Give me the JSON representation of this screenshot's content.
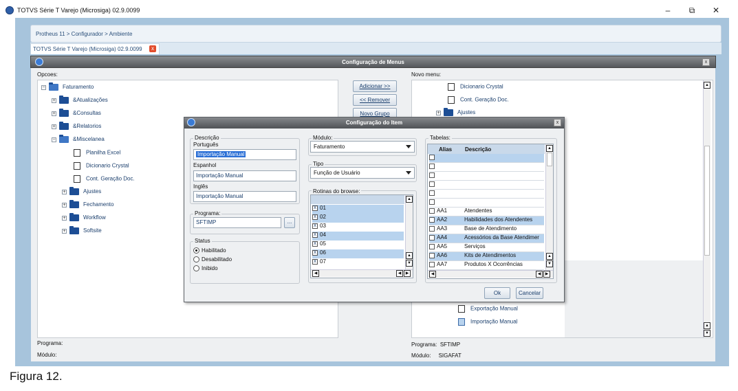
{
  "window": {
    "title": "TOTVS Série T Varejo (Microsiga) 02.9.0099",
    "minimize": "–",
    "maximize": "⧉",
    "close": "✕"
  },
  "breadcrumb": "Protheus 11 > Configurador > Ambiente",
  "tab": {
    "label": "TOTVS Série T Varejo (Microsiga) 02.9.0099",
    "close": "x"
  },
  "dialog": {
    "title": "Configuração de Menus",
    "close": "x"
  },
  "left": {
    "label": "Opcoes:",
    "tree": [
      {
        "label": "Faturamento",
        "kind": "folder"
      },
      {
        "label": "&Atualizações",
        "kind": "folder"
      },
      {
        "label": "&Consultas",
        "kind": "folder"
      },
      {
        "label": "&Relatorios",
        "kind": "folder"
      },
      {
        "label": "&Miscelanea",
        "kind": "folder"
      },
      {
        "label": "Planilha Excel",
        "kind": "doc"
      },
      {
        "label": "Dicionario Crystal",
        "kind": "doc"
      },
      {
        "label": "Cont. Geração Doc.",
        "kind": "doc"
      },
      {
        "label": "Ajustes",
        "kind": "folder"
      },
      {
        "label": "Fechamento",
        "kind": "folder"
      },
      {
        "label": "Workflow",
        "kind": "folder"
      },
      {
        "label": "Softsite",
        "kind": "folder"
      }
    ],
    "programa_label": "Programa:",
    "modulo_label": "Módulo:"
  },
  "buttons": {
    "adicionar": "Adicionar >>",
    "remover": "<< Remover",
    "novo_grupo": "Novo Grupo"
  },
  "right": {
    "label": "Novo menu:",
    "tree_top": [
      "Dicionario Crystal",
      "Cont. Geração Doc.",
      "Ajustes"
    ],
    "tree_bottom": [
      "Exportação Manual",
      "Importação Manual"
    ],
    "programa_label": "Programa:",
    "programa_value": "SFTIMP",
    "modulo_label": "Módulo:",
    "modulo_value": "SIGAFAT"
  },
  "item_dialog": {
    "title": "Configuração do Item",
    "descricao": {
      "legend": "Descrição",
      "portugues_label": "Português",
      "portugues_value": "Importação Manual",
      "espanhol_label": "Espanhol",
      "espanhol_value": "Importação Manual",
      "ingles_label": "Inglês",
      "ingles_value": "Importação Manual"
    },
    "programa": {
      "legend": "Programa:",
      "value": "SFTIMP",
      "browse": "..."
    },
    "status": {
      "legend": "Status",
      "options": [
        "Habilitado",
        "Desabilitado",
        "Inibido"
      ],
      "selected": "Habilitado"
    },
    "modulo": {
      "label": "Módulo:",
      "value": "Faturamento"
    },
    "tipo": {
      "label": "Tipo",
      "value": "Função de Usuário"
    },
    "rotinas": {
      "label": "Rotinas do browse:",
      "rows": [
        {
          "code": "01",
          "checked": true
        },
        {
          "code": "02",
          "checked": true
        },
        {
          "code": "03",
          "checked": true
        },
        {
          "code": "04",
          "checked": true
        },
        {
          "code": "05",
          "checked": true
        },
        {
          "code": "06",
          "checked": true
        },
        {
          "code": "07",
          "checked": true
        }
      ]
    },
    "tabelas": {
      "label": "Tabelas:",
      "col_alias": "Alias",
      "col_descricao": "Descrição",
      "rows": [
        {
          "alias": "",
          "descricao": ""
        },
        {
          "alias": "",
          "descricao": ""
        },
        {
          "alias": "",
          "descricao": ""
        },
        {
          "alias": "",
          "descricao": ""
        },
        {
          "alias": "",
          "descricao": ""
        },
        {
          "alias": "",
          "descricao": ""
        },
        {
          "alias": "AA1",
          "descricao": "Atendentes"
        },
        {
          "alias": "AA2",
          "descricao": "Habilidades dos Atendentes"
        },
        {
          "alias": "AA3",
          "descricao": "Base de Atendimento"
        },
        {
          "alias": "AA4",
          "descricao": "Acessórios da Base Atendimer"
        },
        {
          "alias": "AA5",
          "descricao": "Serviços"
        },
        {
          "alias": "AA6",
          "descricao": "Kits de Atendimentos"
        },
        {
          "alias": "AA7",
          "descricao": "Produtos X Ocorrências"
        }
      ]
    },
    "ok": "Ok",
    "cancelar": "Cancelar"
  },
  "caption": "Figura 12."
}
